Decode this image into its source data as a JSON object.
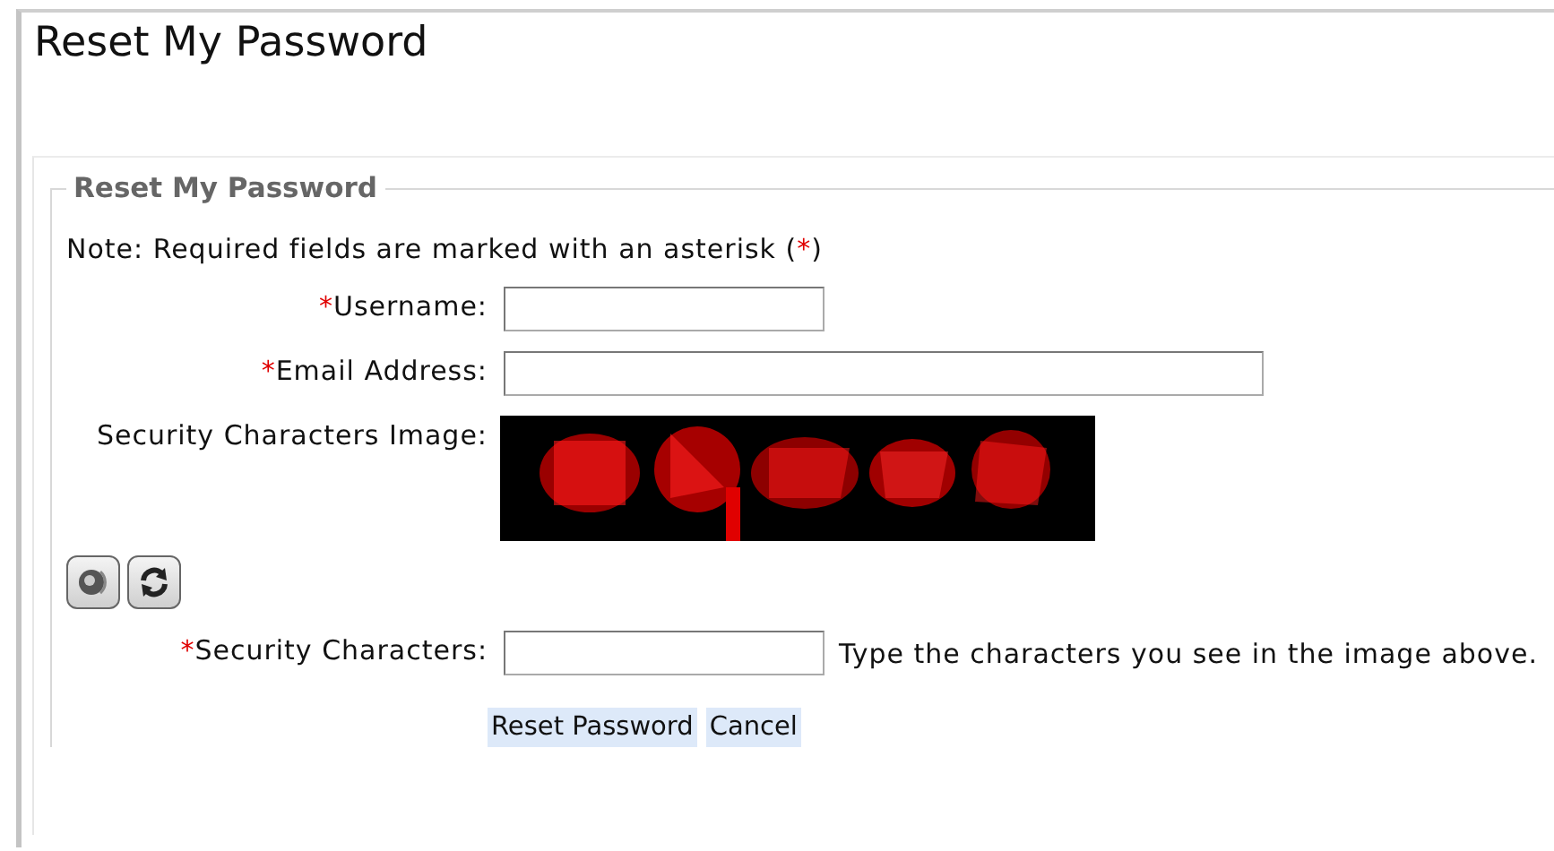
{
  "page_title": "Reset My Password",
  "form": {
    "legend": "Reset My Password",
    "note": {
      "before": "Note: Required fields are marked with an asterisk (",
      "mark": "*",
      "after": ")"
    },
    "fields": [
      {
        "kind": "short_text",
        "required_mark": "*",
        "label": "Username:"
      },
      {
        "kind": "long_text",
        "required_mark": "*",
        "label": "Email Address:"
      },
      {
        "kind": "picture",
        "label": "Security Characters Image:"
      }
    ],
    "captcha_tools": [
      {
        "kind": "audio"
      },
      {
        "kind": "refresh"
      }
    ],
    "security": {
      "required_mark": "*",
      "label": "Security Characters:",
      "hint": "Type the characters you see in the image above."
    },
    "buttons": [
      "Reset Password",
      "Cancel"
    ]
  }
}
